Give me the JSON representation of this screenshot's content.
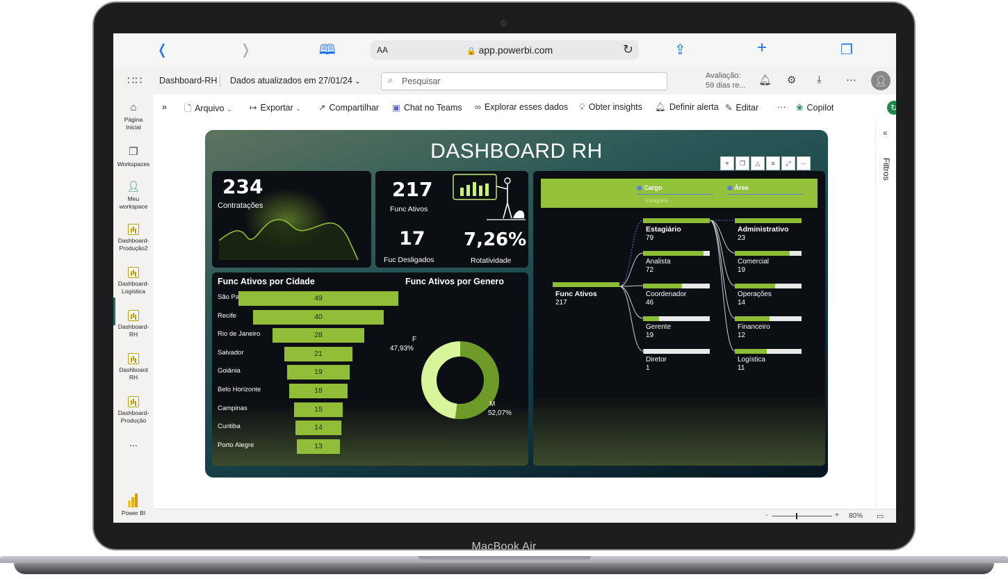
{
  "device": {
    "label": "MacBook Air"
  },
  "browser": {
    "reader_label": "AA",
    "url": "app.powerbi.com",
    "icons": [
      "back-icon",
      "forward-icon",
      "bookmarks-icon",
      "lock-icon",
      "reload-icon",
      "share-icon",
      "new-tab-icon",
      "tabs-icon"
    ]
  },
  "header": {
    "report_name": "Dashboard-RH",
    "updated": "Dados atualizados em 27/01/24",
    "search_placeholder": "Pesquisar",
    "trial_line1": "Avaliação:",
    "trial_line2": "59 dias re..."
  },
  "rail": {
    "items": [
      {
        "label1": "Página",
        "label2": "Inicial"
      },
      {
        "label1": "Workspaces",
        "label2": ""
      },
      {
        "label1": "Meu",
        "label2": "workspace"
      },
      {
        "label1": "Dashboard-",
        "label2": "Produção2"
      },
      {
        "label1": "Dashboard-",
        "label2": "Logística"
      },
      {
        "label1": "Dashboard-",
        "label2": "RH"
      },
      {
        "label1": "Dashboard",
        "label2": "RH"
      },
      {
        "label1": "Dashboard-",
        "label2": "Produção"
      }
    ],
    "more": "...",
    "app": "Power BI"
  },
  "actions": {
    "expand": "»",
    "file": "Arquivo",
    "export": "Exportar",
    "share": "Compartilhar",
    "teams": "Chat no Teams",
    "explore": "Explorar esses dados",
    "insights": "Obter insights",
    "alert": "Definir alerta",
    "edit": "Editar",
    "more": "···",
    "copilot": "Copilot"
  },
  "filters_pane": {
    "label": "Filtros",
    "collapse": "«"
  },
  "status": {
    "zoom_minus": "-",
    "zoom_plus": "+",
    "zoom": "80%",
    "zoom_level": 0.4
  },
  "report": {
    "title": "DASHBOARD RH",
    "kpis": {
      "hires_value": "234",
      "hires_label": "Contratações",
      "active_value": "217",
      "active_label": "Func Ativos",
      "dismissed_value": "17",
      "dismissed_label": "Fuc Desligados",
      "turnover_value": "7,26%",
      "turnover_label": "Rotatividade"
    },
    "city_title": "Func Ativos por Cidade",
    "gender_title": "Func Ativos por Genero",
    "gender_f_label": "F",
    "gender_f_value": "47,93%",
    "gender_m_label": "M",
    "gender_m_value": "52,07%",
    "decomp": {
      "slicer_cargo": "Cargo",
      "slicer_cargo_value": "Estagiário",
      "slicer_area": "Área",
      "root_label": "Func Ativos",
      "root_value": "217"
    }
  },
  "chart_data": [
    {
      "type": "bar",
      "title": "Func Ativos por Cidade",
      "categories": [
        "São Paulo",
        "Recife",
        "Rio de Janeiro",
        "Salvador",
        "Goiânia",
        "Belo Horizonte",
        "Campinas",
        "Curitiba",
        "Porto Alegre"
      ],
      "values": [
        49,
        40,
        28,
        21,
        19,
        18,
        15,
        14,
        13
      ]
    },
    {
      "type": "pie",
      "title": "Func Ativos por Genero",
      "categories": [
        "F",
        "M"
      ],
      "values": [
        47.93,
        52.07
      ],
      "colors": [
        "#d9f59b",
        "#6e9a2a"
      ]
    },
    {
      "type": "bar",
      "title": "Cargo",
      "categories": [
        "Estagiário",
        "Analista",
        "Coordenador",
        "Gerente",
        "Diretor"
      ],
      "values": [
        79,
        72,
        46,
        19,
        1
      ]
    },
    {
      "type": "bar",
      "title": "Área",
      "categories": [
        "Administrativo",
        "Comercial",
        "Operações",
        "Financeiro",
        "Logística"
      ],
      "values": [
        23,
        19,
        14,
        12,
        11
      ]
    }
  ],
  "colors": {
    "accent": "#92bd38",
    "pbi_green": "#117865"
  }
}
